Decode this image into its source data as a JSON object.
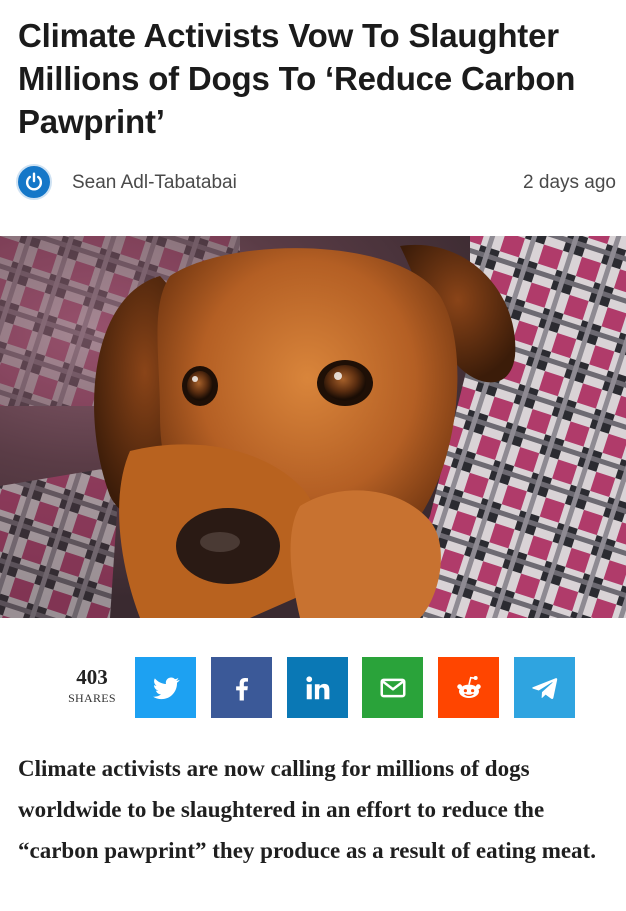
{
  "article": {
    "headline": "Climate Activists Vow To Slaughter Millions of Dogs To ‘Reduce Carbon Pawprint’",
    "author": "Sean Adl-Tabatabai",
    "timestamp": "2 days ago",
    "avatar_icon": "power-icon",
    "hero_image": "puppy-resting-on-plaid-blanket",
    "body": "Climate activists are now calling for millions of dogs worldwide to be slaughtered in an effort to reduce the “carbon pawprint” they produce as a result of eating meat."
  },
  "share": {
    "count": "403",
    "count_label": "SHARES",
    "buttons": [
      {
        "network": "twitter",
        "icon": "twitter-bird-icon",
        "color": "#1da1f2"
      },
      {
        "network": "facebook",
        "icon": "facebook-f-icon",
        "color": "#3b5998"
      },
      {
        "network": "linkedin",
        "icon": "linkedin-in-icon",
        "color": "#0a78b5"
      },
      {
        "network": "email",
        "icon": "envelope-icon",
        "color": "#2aa33a"
      },
      {
        "network": "reddit",
        "icon": "reddit-alien-icon",
        "color": "#ff4500"
      },
      {
        "network": "telegram",
        "icon": "paper-plane-icon",
        "color": "#2fa4e0"
      }
    ]
  }
}
